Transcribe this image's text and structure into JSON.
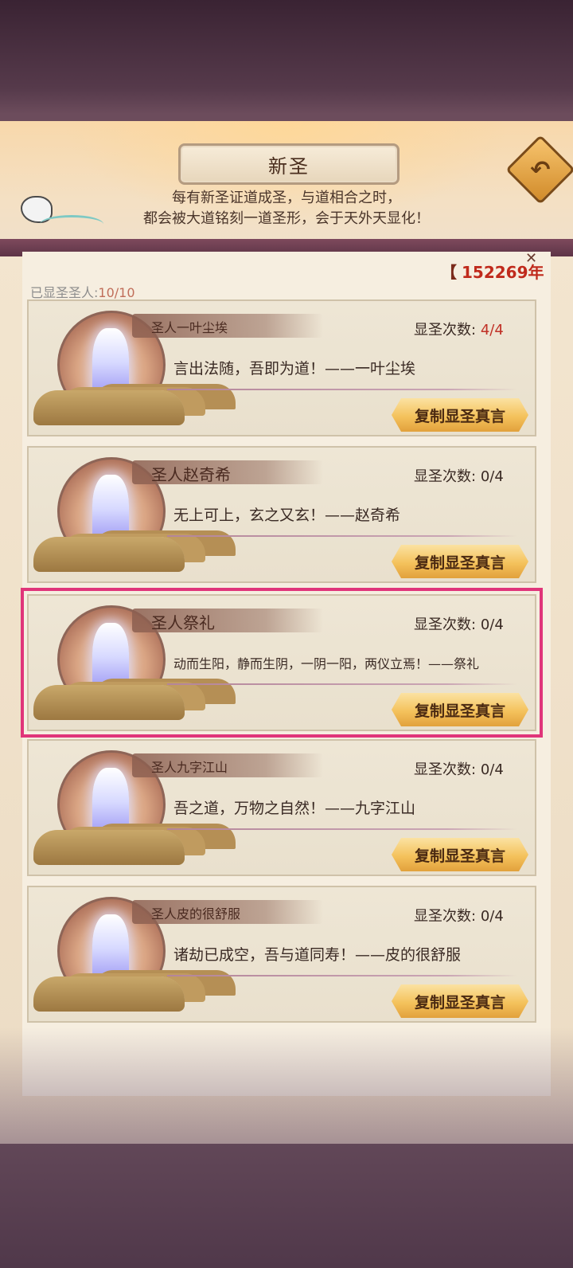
{
  "header": {
    "title": "新圣",
    "intro_line1": "每有新圣证道成圣，与道相合之时，",
    "intro_line2": "都会被大道铭刻一道圣形，会于天外天显化！",
    "back_icon": "back-arrow-icon"
  },
  "currency": {
    "bracket": "【",
    "value": "152269年",
    "close": "✕"
  },
  "count": {
    "label": "已显圣圣人:",
    "value": "10/10"
  },
  "saints": [
    {
      "name": "圣人一叶尘埃",
      "times_label": "显圣次数:",
      "times": "4/4",
      "quote": "言出法随，吾即为道！——一叶尘埃",
      "button": "复制显圣真言"
    },
    {
      "name": "圣人赵奇希",
      "times_label": "显圣次数:",
      "times": "0/4",
      "quote": "无上可上，玄之又玄！——赵奇希",
      "button": "复制显圣真言"
    },
    {
      "name": "圣人祭礼",
      "times_label": "显圣次数:",
      "times": "0/4",
      "quote": "动而生阳，静而生阴，一阴一阳，两仪立焉！——祭礼",
      "button": "复制显圣真言"
    },
    {
      "name": "圣人九字江山",
      "times_label": "显圣次数:",
      "times": "0/4",
      "quote": "吾之道，万物之自然！——九字江山",
      "button": "复制显圣真言"
    },
    {
      "name": "圣人皮的很舒服",
      "times_label": "显圣次数:",
      "times": "0/4",
      "quote": "诸劫已成空，吾与道同寿！——皮的很舒服",
      "button": "复制显圣真言"
    }
  ],
  "colors": {
    "highlight": "#e0357a",
    "accent_red": "#c02a1c",
    "button_gold": "#f4c25c"
  }
}
